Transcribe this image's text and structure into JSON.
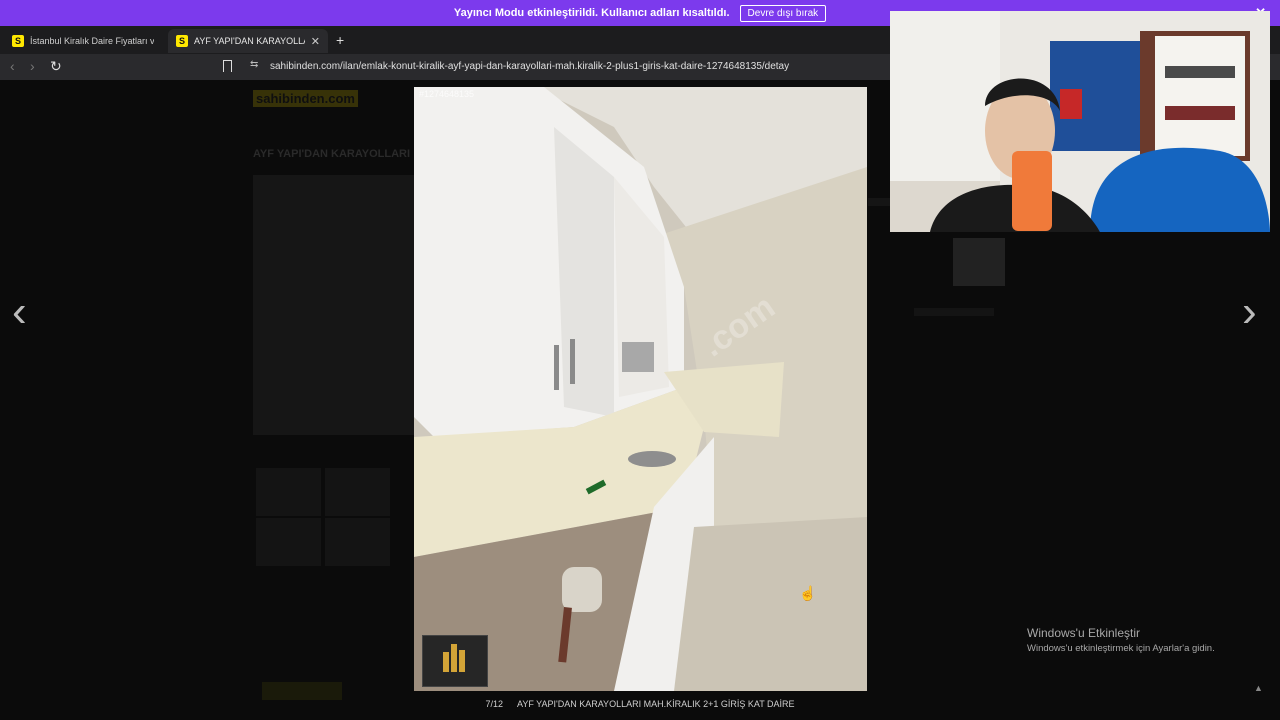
{
  "banner": {
    "text": "Yayıncı Modu etkinleştirildi. Kullanıcı adları kısaltıldı.",
    "button_label": "Devre dışı bırak",
    "close_glyph": "✕"
  },
  "tabs": [
    {
      "favicon": "S",
      "title": "İstanbul Kiralık Daire Fiyatları ve Kiralı",
      "close": ""
    },
    {
      "favicon": "S",
      "title": "AYF YAPI'DAN KARAYOLLARI M",
      "close": "✕"
    }
  ],
  "newtab_glyph": "+",
  "nav": {
    "back": "‹",
    "forward": "›",
    "reload": "↻",
    "siteinfo": "⇆"
  },
  "url": "sahibinden.com/ilan/emlak-konut-kiralik-ayf-yapi-dan-karayollari-mah.kiralik-2-plus1-giris-kat-daire-1274648135/detay",
  "background_page": {
    "logo": "sahibinden.com",
    "title": "AYF YAPI'DAN KARAYOLLARI"
  },
  "gallery": {
    "listing_id": "#1274648135",
    "watermark": ".com",
    "counter": "7/12",
    "caption": "AYF YAPI'DAN KARAYOLLARI MAH.KİRALIK 2+1 GİRİŞ KAT DAİRE",
    "prev_glyph": "‹",
    "next_glyph": "›"
  },
  "windows_activation": {
    "title": "Windows'u Etkinleştir",
    "subtitle": "Windows'u etkinleştirmek için Ayarlar'a gidin."
  },
  "scroll_top_glyph": "▲",
  "colors": {
    "banner": "#7c3aed",
    "brand": "#ffe800",
    "overlay": "#0b0b0b"
  }
}
